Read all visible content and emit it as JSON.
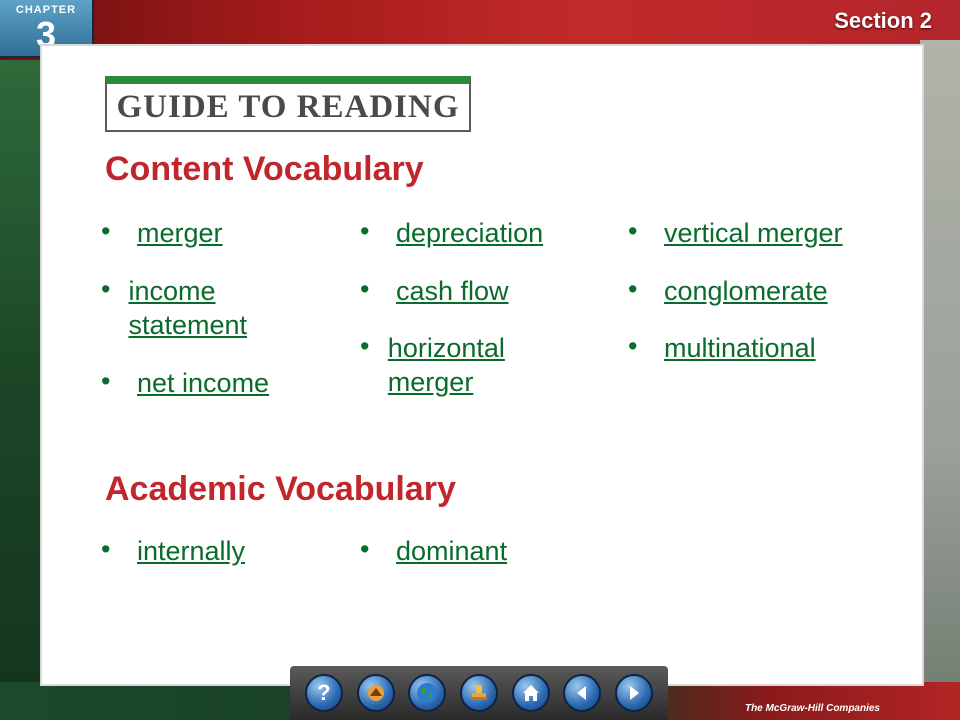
{
  "header": {
    "chapter_label": "CHAPTER",
    "chapter_number": "3",
    "section_label": "Section 2"
  },
  "guide_title": "GUIDE TO READING",
  "content_vocabulary": {
    "heading": "Content Vocabulary",
    "columns": [
      [
        "merger",
        "income statement",
        "net income"
      ],
      [
        "depreciation",
        "cash flow",
        "horizontal merger"
      ],
      [
        "vertical merger",
        "conglomerate",
        "multinational"
      ]
    ]
  },
  "academic_vocabulary": {
    "heading": "Academic Vocabulary",
    "terms": [
      "internally",
      "dominant"
    ]
  },
  "nav": {
    "buttons": [
      "help-icon",
      "resources-icon",
      "globe-icon",
      "stamp-icon",
      "home-icon",
      "back-icon",
      "forward-icon"
    ],
    "help_glyph": "?"
  },
  "footer": {
    "publisher": "The McGraw-Hill Companies"
  }
}
